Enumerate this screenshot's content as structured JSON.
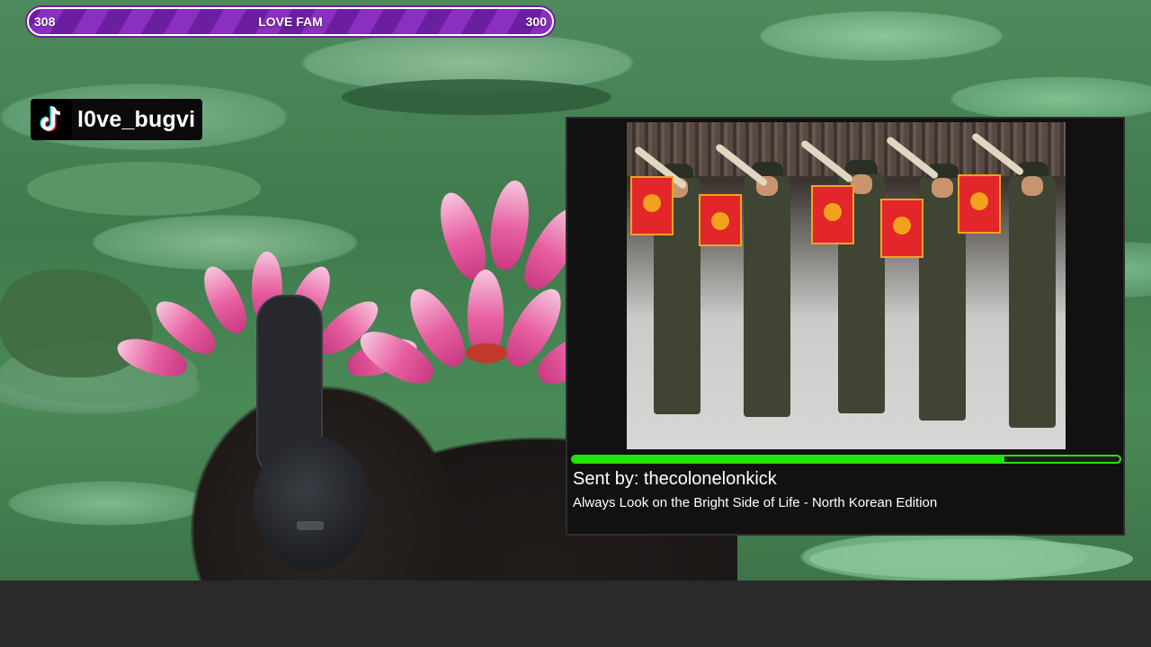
{
  "goal_bar": {
    "current": "308",
    "title": "LOVE FAM",
    "target": "300",
    "colors": {
      "stripe_a": "#8a2fc0",
      "stripe_b": "#6a1fa0",
      "border": "#ffffff"
    }
  },
  "social_handle": {
    "icon": "tiktok-icon",
    "username": "l0ve_bugvi"
  },
  "media_share": {
    "sent_by": "Sent by: thecolonelonkick",
    "title": "Always Look on the Bright Side of Life - North Korean Edition",
    "progress": 0.79,
    "colors": {
      "progress": "#22e60a",
      "panel": "#111111"
    }
  }
}
